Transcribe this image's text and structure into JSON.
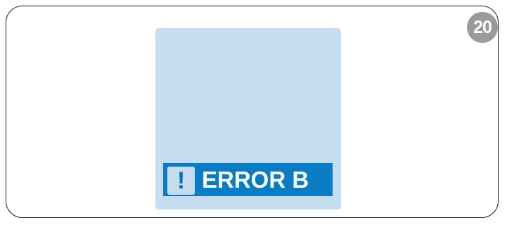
{
  "step_badge": {
    "number": "20",
    "color": "#9a9a9a"
  },
  "display": {
    "background_color": "#c6dcf0",
    "error_bar_color": "#0a7cc3",
    "alert_icon": {
      "name": "exclamation-icon",
      "glyph": "!"
    },
    "error_label": "ERROR B"
  }
}
